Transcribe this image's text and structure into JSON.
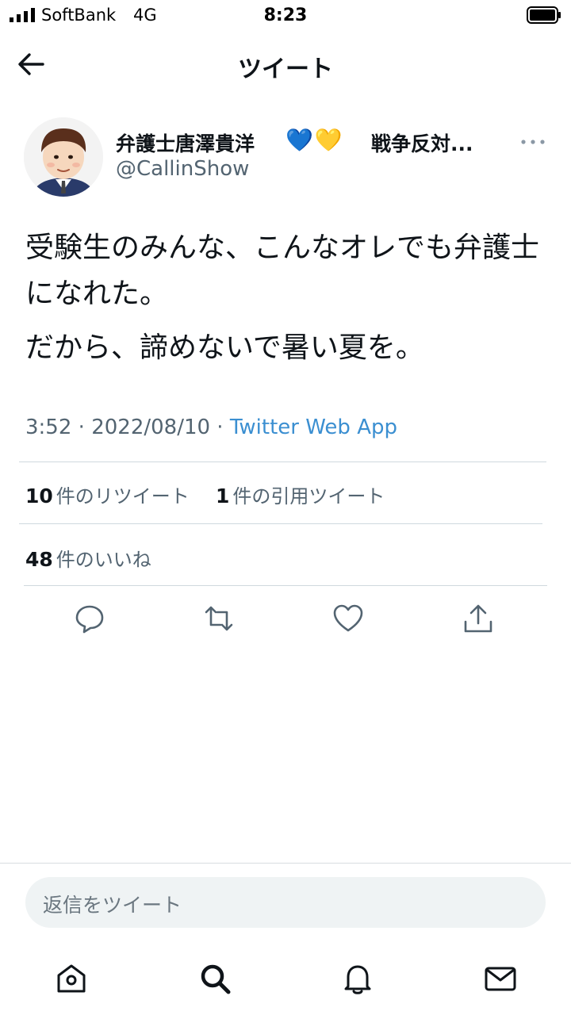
{
  "status_bar": {
    "carrier": "SoftBank",
    "network": "4G",
    "time": "8:23"
  },
  "header": {
    "title": "ツイート",
    "back_icon": "arrow-left-icon"
  },
  "author": {
    "name": "弁護士唐澤貴洋",
    "hearts": "💙💛",
    "name_suffix": "戦争反対...",
    "handle": "@CallinShow"
  },
  "tweet": {
    "line1": "受験生のみんな、こんなオレでも弁護士になれた。",
    "line2": "だから、諦めないで暑い夏を。"
  },
  "meta": {
    "time": "3:52",
    "separator1": " · ",
    "date": "2022/08/10",
    "separator2": " · ",
    "source": "Twitter Web App"
  },
  "stats": {
    "retweets_count": "10",
    "retweets_label": "件のリツイート",
    "quotes_count": "1",
    "quotes_label": "件の引用ツイート",
    "likes_count": "48",
    "likes_label": "件のいいね"
  },
  "reply": {
    "placeholder": "返信をツイート"
  },
  "colors": {
    "link": "#3b8fd1",
    "muted": "#536471",
    "text": "#0f1419"
  }
}
